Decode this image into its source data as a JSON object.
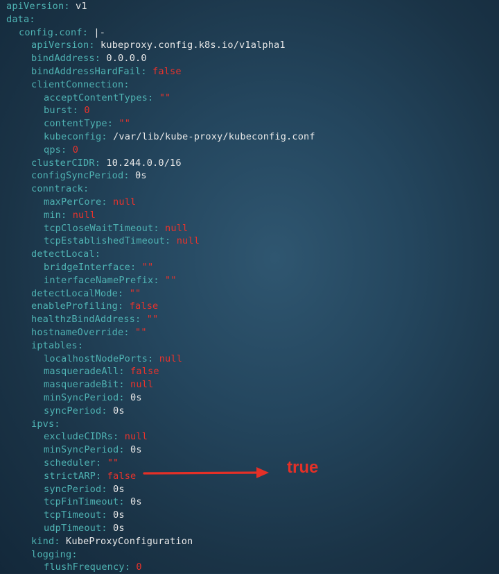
{
  "yaml_lines": [
    {
      "indent": 0,
      "key": "apiVersion",
      "value": "v1",
      "vtype": "plain"
    },
    {
      "indent": 0,
      "key": "data",
      "value": "",
      "vtype": "none"
    },
    {
      "indent": 1,
      "key": "config.conf",
      "value": "|-",
      "vtype": "plain"
    },
    {
      "indent": 2,
      "key": "apiVersion",
      "value": "kubeproxy.config.k8s.io/v1alpha1",
      "vtype": "plain"
    },
    {
      "indent": 2,
      "key": "bindAddress",
      "value": "0.0.0.0",
      "vtype": "plain"
    },
    {
      "indent": 2,
      "key": "bindAddressHardFail",
      "value": "false",
      "vtype": "red"
    },
    {
      "indent": 2,
      "key": "clientConnection",
      "value": "",
      "vtype": "none"
    },
    {
      "indent": 3,
      "key": "acceptContentTypes",
      "value": "\"\"",
      "vtype": "red"
    },
    {
      "indent": 3,
      "key": "burst",
      "value": "0",
      "vtype": "red"
    },
    {
      "indent": 3,
      "key": "contentType",
      "value": "\"\"",
      "vtype": "red"
    },
    {
      "indent": 3,
      "key": "kubeconfig",
      "value": "/var/lib/kube-proxy/kubeconfig.conf",
      "vtype": "plain"
    },
    {
      "indent": 3,
      "key": "qps",
      "value": "0",
      "vtype": "red"
    },
    {
      "indent": 2,
      "key": "clusterCIDR",
      "value": "10.244.0.0/16",
      "vtype": "plain"
    },
    {
      "indent": 2,
      "key": "configSyncPeriod",
      "value": "0s",
      "vtype": "plain"
    },
    {
      "indent": 2,
      "key": "conntrack",
      "value": "",
      "vtype": "none"
    },
    {
      "indent": 3,
      "key": "maxPerCore",
      "value": "null",
      "vtype": "red"
    },
    {
      "indent": 3,
      "key": "min",
      "value": "null",
      "vtype": "red"
    },
    {
      "indent": 3,
      "key": "tcpCloseWaitTimeout",
      "value": "null",
      "vtype": "red"
    },
    {
      "indent": 3,
      "key": "tcpEstablishedTimeout",
      "value": "null",
      "vtype": "red"
    },
    {
      "indent": 2,
      "key": "detectLocal",
      "value": "",
      "vtype": "none"
    },
    {
      "indent": 3,
      "key": "bridgeInterface",
      "value": "\"\"",
      "vtype": "red"
    },
    {
      "indent": 3,
      "key": "interfaceNamePrefix",
      "value": "\"\"",
      "vtype": "red"
    },
    {
      "indent": 2,
      "key": "detectLocalMode",
      "value": "\"\"",
      "vtype": "red"
    },
    {
      "indent": 2,
      "key": "enableProfiling",
      "value": "false",
      "vtype": "red"
    },
    {
      "indent": 2,
      "key": "healthzBindAddress",
      "value": "\"\"",
      "vtype": "red"
    },
    {
      "indent": 2,
      "key": "hostnameOverride",
      "value": "\"\"",
      "vtype": "red"
    },
    {
      "indent": 2,
      "key": "iptables",
      "value": "",
      "vtype": "none"
    },
    {
      "indent": 3,
      "key": "localhostNodePorts",
      "value": "null",
      "vtype": "red"
    },
    {
      "indent": 3,
      "key": "masqueradeAll",
      "value": "false",
      "vtype": "red"
    },
    {
      "indent": 3,
      "key": "masqueradeBit",
      "value": "null",
      "vtype": "red"
    },
    {
      "indent": 3,
      "key": "minSyncPeriod",
      "value": "0s",
      "vtype": "plain"
    },
    {
      "indent": 3,
      "key": "syncPeriod",
      "value": "0s",
      "vtype": "plain"
    },
    {
      "indent": 2,
      "key": "ipvs",
      "value": "",
      "vtype": "none"
    },
    {
      "indent": 3,
      "key": "excludeCIDRs",
      "value": "null",
      "vtype": "red"
    },
    {
      "indent": 3,
      "key": "minSyncPeriod",
      "value": "0s",
      "vtype": "plain"
    },
    {
      "indent": 3,
      "key": "scheduler",
      "value": "\"\"",
      "vtype": "red"
    },
    {
      "indent": 3,
      "key": "strictARP",
      "value": "false",
      "vtype": "red"
    },
    {
      "indent": 3,
      "key": "syncPeriod",
      "value": "0s",
      "vtype": "plain"
    },
    {
      "indent": 3,
      "key": "tcpFinTimeout",
      "value": "0s",
      "vtype": "plain"
    },
    {
      "indent": 3,
      "key": "tcpTimeout",
      "value": "0s",
      "vtype": "plain"
    },
    {
      "indent": 3,
      "key": "udpTimeout",
      "value": "0s",
      "vtype": "plain"
    },
    {
      "indent": 2,
      "key": "kind",
      "value": "KubeProxyConfiguration",
      "vtype": "plain"
    },
    {
      "indent": 2,
      "key": "logging",
      "value": "",
      "vtype": "none"
    },
    {
      "indent": 3,
      "key": "flushFrequency",
      "value": "0",
      "vtype": "red"
    }
  ],
  "annotation": {
    "text": "true"
  },
  "colors": {
    "key": "#4fb3b3",
    "plain": "#e8e8e8",
    "red": "#e8332c",
    "background": "#24465e",
    "annotation": "#e53027"
  }
}
